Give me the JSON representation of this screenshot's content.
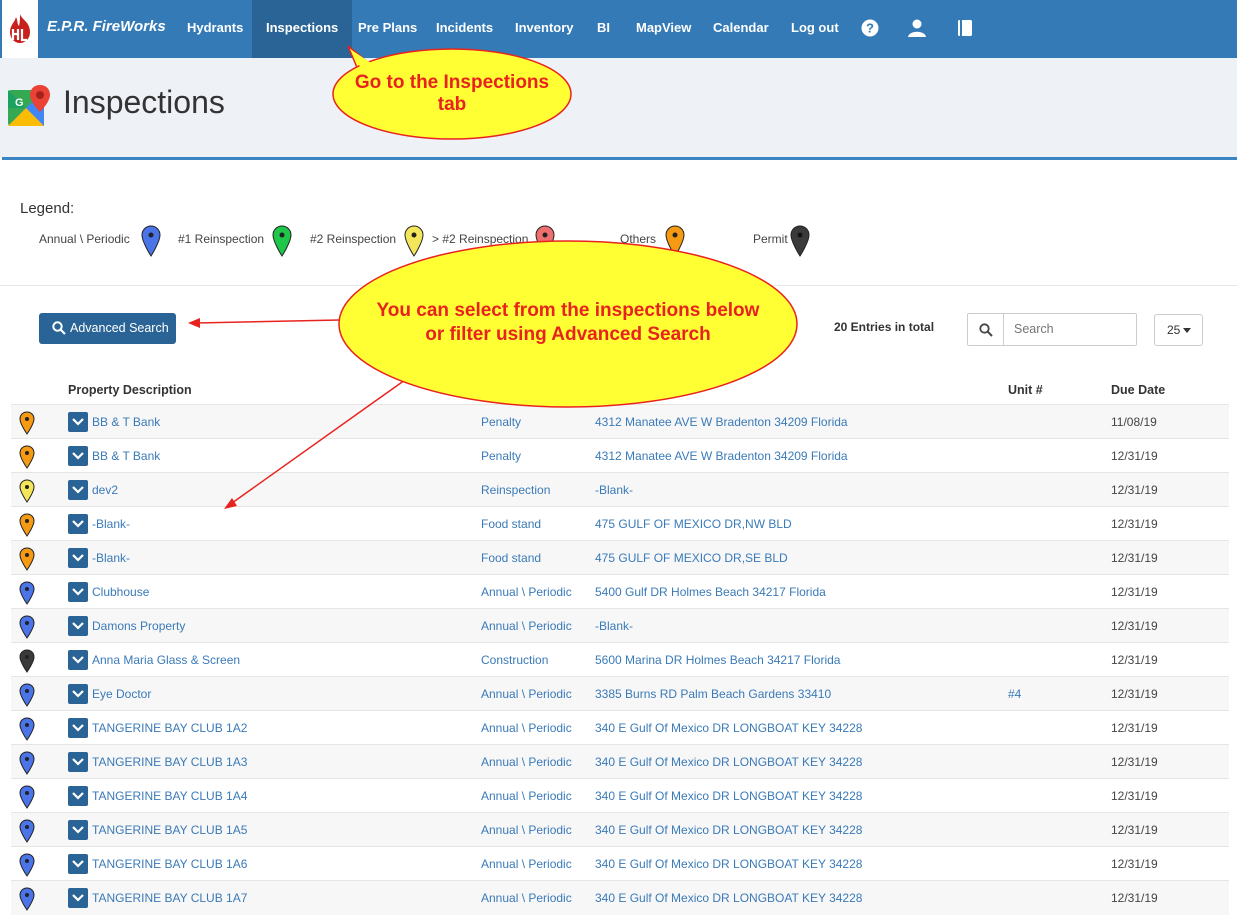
{
  "nav": {
    "brand": "E.P.R. FireWorks",
    "items": [
      {
        "label": "Hydrants"
      },
      {
        "label": "Inspections",
        "active": true
      },
      {
        "label": "Pre Plans"
      },
      {
        "label": "Incidents"
      },
      {
        "label": "Inventory"
      },
      {
        "label": "BI"
      },
      {
        "label": "MapView"
      },
      {
        "label": "Calendar"
      },
      {
        "label": "Log out"
      }
    ],
    "icons": [
      "help-icon",
      "user-icon",
      "book-icon"
    ]
  },
  "page": {
    "title": "Inspections"
  },
  "callouts": {
    "tab_line1": "Go to the Inspections",
    "tab_line2": "tab",
    "search_line1": "You can select from the inspections below",
    "search_line2": "or filter using Advanced Search"
  },
  "legend": {
    "title": "Legend:",
    "items": [
      {
        "label": "Annual \\ Periodic",
        "color": "#4a74e8"
      },
      {
        "label": "#1 Reinspection",
        "color": "#1ec64a"
      },
      {
        "label": "#2 Reinspection",
        "color": "#f4e65a"
      },
      {
        "label": "> #2 Reinspection",
        "color": "#ef6f6f"
      },
      {
        "label": "Others",
        "color": "#f59a12"
      },
      {
        "label": "Permit",
        "color": "#3a3a3a"
      }
    ]
  },
  "toolbar": {
    "advanced_search": "Advanced Search",
    "entries_total": "20 Entries in total",
    "search_placeholder": "Search",
    "page_size": "25"
  },
  "table": {
    "headers": {
      "property": "Property Description",
      "unit": "Unit #",
      "due": "Due Date"
    },
    "rows": [
      {
        "pin": "#f59a12",
        "property": "BB & T Bank",
        "type": "Penalty",
        "address": "4312 Manatee AVE W Bradenton 34209 Florida",
        "unit": "",
        "due": "11/08/19"
      },
      {
        "pin": "#f59a12",
        "property": "BB & T Bank",
        "type": "Penalty",
        "address": "4312 Manatee AVE W Bradenton 34209 Florida",
        "unit": "",
        "due": "12/31/19"
      },
      {
        "pin": "#f4e65a",
        "property": "dev2",
        "type": "Reinspection",
        "address": "-Blank-",
        "unit": "",
        "due": "12/31/19"
      },
      {
        "pin": "#f59a12",
        "property": "-Blank-",
        "type": "Food stand",
        "address": "475 GULF OF MEXICO DR,NW BLD",
        "unit": "",
        "due": "12/31/19"
      },
      {
        "pin": "#f59a12",
        "property": "-Blank-",
        "type": "Food stand",
        "address": "475 GULF OF MEXICO DR,SE BLD",
        "unit": "",
        "due": "12/31/19"
      },
      {
        "pin": "#4a74e8",
        "property": "Clubhouse",
        "type": "Annual \\ Periodic",
        "address": "5400 Gulf DR Holmes Beach 34217 Florida",
        "unit": "",
        "due": "12/31/19"
      },
      {
        "pin": "#4a74e8",
        "property": "Damons Property",
        "type": "Annual \\ Periodic",
        "address": "-Blank-",
        "unit": "",
        "due": "12/31/19"
      },
      {
        "pin": "#3a3a3a",
        "property": "Anna Maria Glass & Screen",
        "type": "Construction",
        "address": "5600 Marina DR Holmes Beach 34217 Florida",
        "unit": "",
        "due": "12/31/19"
      },
      {
        "pin": "#4a74e8",
        "property": "Eye Doctor",
        "type": "Annual \\ Periodic",
        "address": "3385 Burns RD Palm Beach Gardens 33410",
        "unit": "#4",
        "due": "12/31/19"
      },
      {
        "pin": "#4a74e8",
        "property": "TANGERINE BAY CLUB 1A2",
        "type": "Annual \\ Periodic",
        "address": "340 E Gulf Of Mexico DR LONGBOAT KEY 34228",
        "unit": "",
        "due": "12/31/19"
      },
      {
        "pin": "#4a74e8",
        "property": "TANGERINE BAY CLUB 1A3",
        "type": "Annual \\ Periodic",
        "address": "340 E Gulf Of Mexico DR LONGBOAT KEY 34228",
        "unit": "",
        "due": "12/31/19"
      },
      {
        "pin": "#4a74e8",
        "property": "TANGERINE BAY CLUB 1A4",
        "type": "Annual \\ Periodic",
        "address": "340 E Gulf Of Mexico DR LONGBOAT KEY 34228",
        "unit": "",
        "due": "12/31/19"
      },
      {
        "pin": "#4a74e8",
        "property": "TANGERINE BAY CLUB 1A5",
        "type": "Annual \\ Periodic",
        "address": "340 E Gulf Of Mexico DR LONGBOAT KEY 34228",
        "unit": "",
        "due": "12/31/19"
      },
      {
        "pin": "#4a74e8",
        "property": "TANGERINE BAY CLUB 1A6",
        "type": "Annual \\ Periodic",
        "address": "340 E Gulf Of Mexico DR LONGBOAT KEY 34228",
        "unit": "",
        "due": "12/31/19"
      },
      {
        "pin": "#4a74e8",
        "property": "TANGERINE BAY CLUB 1A7",
        "type": "Annual \\ Periodic",
        "address": "340 E Gulf Of Mexico DR LONGBOAT KEY 34228",
        "unit": "",
        "due": "12/31/19"
      }
    ]
  }
}
